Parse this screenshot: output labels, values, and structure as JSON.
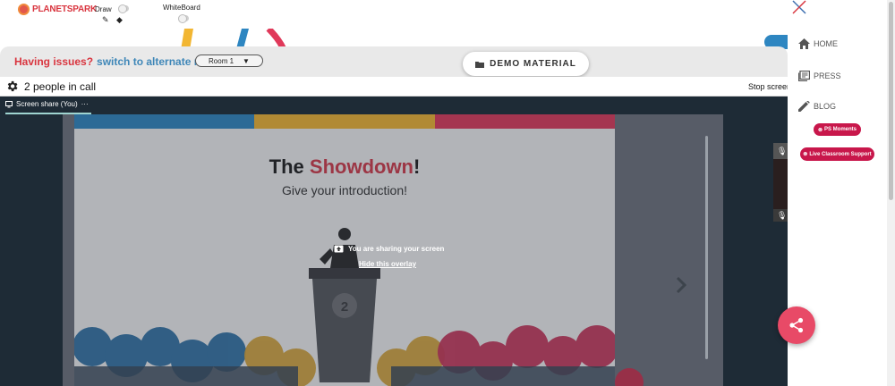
{
  "toolbar": {
    "brand": "PLANETSPARK",
    "draw_label": "Draw",
    "whiteboard_label": "WhiteBoard"
  },
  "banner": {
    "issues_text": "Having issues?",
    "switch_text": "switch to alternate room",
    "room_value": "Room 1",
    "demo_material_label": "DEMO MATERIAL"
  },
  "call": {
    "people_text": "2 people in call",
    "stop_screen_label": "Stop screen"
  },
  "screen_share": {
    "tab_label": "Screen share (You)",
    "tab_more": "···",
    "overlay_message": "You are sharing your screen",
    "hide_overlay_label": "Hide this overlay"
  },
  "slide": {
    "title_prefix": "The",
    "title_highlight": "Showdown",
    "title_suffix": "!",
    "subtitle": "Give your introduction!",
    "podium_number": "2",
    "bar_colors": [
      "#2e86c1",
      "#f2b632",
      "#e0395a"
    ]
  },
  "sidebar": {
    "items": [
      {
        "label": "HOME",
        "icon": "home-icon"
      },
      {
        "label": "PRESS",
        "icon": "press-icon"
      },
      {
        "label": "BLOG",
        "icon": "pencil-icon"
      }
    ],
    "ps_moments_label": "PS Moments",
    "live_support_label": "Live Classroom Support"
  },
  "colors": {
    "brand_red": "#d9353f",
    "link_blue": "#3f87b8",
    "pill_crimson": "#c8174b",
    "share_fab": "#e84a67"
  }
}
